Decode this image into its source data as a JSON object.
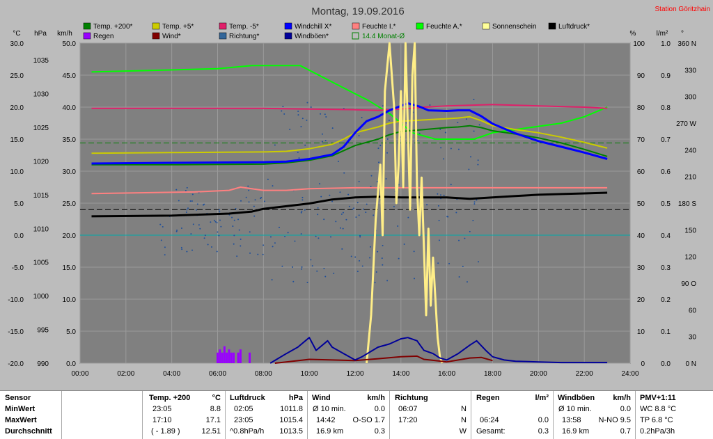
{
  "title": "Montag, 19.09.2016",
  "station": "Station Göritzhain",
  "axis_units": {
    "celsius": "°C",
    "hpa": "hPa",
    "kmh": "km/h",
    "percent": "%",
    "rain": "l/m²",
    "deg": "°"
  },
  "chart_data": {
    "type": "line",
    "x_ticks": [
      "00:00",
      "02:00",
      "04:00",
      "06:00",
      "08:00",
      "10:00",
      "12:00",
      "14:00",
      "16:00",
      "18:00",
      "20:00",
      "22:00",
      "24:00"
    ],
    "xlim": [
      0,
      24
    ],
    "axes": {
      "temp_c": {
        "min": -20,
        "max": 30,
        "ticks": [
          "-20.0",
          "-15.0",
          "-10.0",
          "-5.0",
          "0.0",
          "5.0",
          "10.0",
          "15.0",
          "20.0",
          "25.0",
          "30.0"
        ]
      },
      "pressure_hpa": {
        "min": 990,
        "max": 1037.5,
        "ticks": [
          "990",
          "995",
          "1000",
          "1005",
          "1010",
          "1015",
          "1020",
          "1025",
          "1030",
          "1035"
        ]
      },
      "wind_kmh": {
        "min": 0,
        "max": 50,
        "ticks": [
          "0.0",
          "5.0",
          "10.0",
          "15.0",
          "20.0",
          "25.0",
          "30.0",
          "35.0",
          "40.0",
          "45.0",
          "50.0"
        ]
      },
      "percent": {
        "min": 0,
        "max": 100,
        "ticks": [
          "0",
          "10",
          "20",
          "30",
          "40",
          "50",
          "60",
          "70",
          "80",
          "90",
          "100"
        ]
      },
      "rain": {
        "min": 0,
        "max": 1,
        "ticks": [
          "0.0",
          "0.1",
          "0.2",
          "0.3",
          "0.4",
          "0.5",
          "0.6",
          "0.7",
          "0.8",
          "0.9",
          "1.0"
        ]
      },
      "direction": {
        "min": 0,
        "max": 360,
        "ticks": [
          "0 N",
          "30",
          "60",
          "90 O",
          "120",
          "150",
          "180 S",
          "210",
          "240",
          "270 W",
          "300",
          "330",
          "360 N"
        ]
      }
    },
    "legend": [
      {
        "name": "Temp. +200*",
        "color": "#008000"
      },
      {
        "name": "Temp. +5*",
        "color": "#cccc00"
      },
      {
        "name": "Temp. -5*",
        "color": "#e0206a"
      },
      {
        "name": "Windchill X*",
        "color": "#0000ff"
      },
      {
        "name": "Feuchte I.*",
        "color": "#ff8080"
      },
      {
        "name": "Feuchte A.*",
        "color": "#00ff00"
      },
      {
        "name": "Sonnenschein",
        "color": "#ffff99"
      },
      {
        "name": "Luftdruck*",
        "color": "#000000"
      },
      {
        "name": "Regen",
        "color": "#9900ff"
      },
      {
        "name": "Wind*",
        "color": "#800000"
      },
      {
        "name": "Richtung*",
        "color": "#336699"
      },
      {
        "name": "Windböen*",
        "color": "#000099"
      },
      {
        "name": "14.4 Monat-Ø",
        "color": "#008000"
      }
    ],
    "reference_lines": [
      {
        "name": "14.4 Monat-Ø",
        "axis": "temp_c",
        "value": 14.4,
        "color": "#008000",
        "dash": true
      },
      {
        "name": "pressure-ref",
        "axis": "temp_c",
        "value": 4.0,
        "color": "#000000",
        "dash": true
      },
      {
        "name": "zero-line",
        "axis": "temp_c",
        "value": 0.0,
        "color": "#00aaaa",
        "dash": false
      }
    ],
    "series": [
      {
        "name": "Feuchte A.*",
        "axis": "percent",
        "color": "#00ff00",
        "width": 2,
        "x": [
          0.5,
          6,
          7.5,
          9.6,
          11.5,
          12.6,
          13.5,
          14.5,
          15.5,
          16.5,
          17.2,
          18,
          19,
          20,
          21,
          22,
          23
        ],
        "y": [
          91,
          92,
          93,
          93,
          86,
          82,
          78,
          72,
          70,
          70,
          70,
          72,
          73,
          74,
          75,
          77,
          80
        ]
      },
      {
        "name": "Temp. -5*",
        "axis": "temp_c",
        "color": "#e0206a",
        "width": 2,
        "x": [
          0.5,
          4,
          8,
          10,
          12,
          13,
          14,
          15,
          16,
          17,
          18,
          19,
          20,
          21,
          22,
          23
        ],
        "y": [
          19.8,
          19.8,
          19.8,
          19.7,
          19.6,
          19.5,
          19.7,
          20.0,
          20.2,
          20.3,
          20.4,
          20.3,
          20.2,
          20.1,
          20.0,
          19.8
        ]
      },
      {
        "name": "Temp. +5*",
        "axis": "temp_c",
        "color": "#cccc00",
        "width": 2,
        "x": [
          0.5,
          4,
          8,
          9,
          10,
          11,
          11.5,
          12,
          13,
          13.5,
          14,
          15,
          16,
          16.5,
          17,
          17.5,
          18,
          19,
          20,
          21,
          22,
          23
        ],
        "y": [
          12.8,
          12.9,
          13.0,
          13.1,
          13.5,
          14.2,
          15.0,
          16.0,
          16.9,
          17.5,
          17.8,
          18.0,
          18.2,
          18.3,
          18.5,
          17.9,
          17.1,
          16.5,
          16.0,
          15.3,
          14.5,
          13.6
        ]
      },
      {
        "name": "Temp. +200*",
        "axis": "temp_c",
        "color": "#008000",
        "width": 2,
        "x": [
          0.5,
          4,
          8,
          9,
          10,
          11,
          11.5,
          12,
          13,
          13.5,
          14,
          15,
          16,
          16.5,
          17,
          17.5,
          18,
          19,
          20,
          21,
          22,
          23
        ],
        "y": [
          11.0,
          11.0,
          11.1,
          11.3,
          11.7,
          12.4,
          13.2,
          14.0,
          15.0,
          15.7,
          16.2,
          16.5,
          16.8,
          16.9,
          17.1,
          16.8,
          16.3,
          15.8,
          15.2,
          14.4,
          13.4,
          12.3
        ]
      },
      {
        "name": "Windchill X*",
        "axis": "temp_c",
        "color": "#0000ff",
        "width": 3,
        "x": [
          0.5,
          4,
          8,
          9,
          10,
          11,
          11.5,
          12,
          12.5,
          13,
          13.5,
          14,
          14.3,
          14.8,
          15.2,
          16,
          16.5,
          17,
          17.5,
          18,
          19,
          20,
          21,
          22,
          23
        ],
        "y": [
          11.2,
          11.3,
          11.4,
          11.5,
          11.9,
          12.6,
          13.8,
          16.0,
          17.8,
          18.5,
          19.5,
          20.2,
          20.6,
          20.1,
          19.5,
          19.4,
          19.5,
          19.5,
          18.6,
          17.4,
          15.9,
          14.7,
          13.8,
          12.9,
          11.9
        ]
      },
      {
        "name": "Feuchte I.*",
        "axis": "percent",
        "color": "#ff8080",
        "width": 2,
        "x": [
          0.5,
          5,
          6.5,
          7,
          8,
          9,
          10,
          12,
          14,
          16,
          18,
          20,
          23
        ],
        "y": [
          53,
          53.5,
          54,
          55,
          54,
          54,
          54.5,
          54.8,
          54.8,
          54.8,
          54.8,
          54.8,
          54.8
        ]
      },
      {
        "name": "Luftdruck*",
        "axis": "pressure_hpa",
        "color": "#000000",
        "width": 3,
        "x": [
          0.5,
          4,
          6.5,
          7.5,
          8,
          9,
          10,
          11,
          12,
          13,
          14,
          15,
          16,
          17,
          18,
          19,
          20,
          21,
          22,
          23
        ],
        "y": [
          1011.8,
          1011.9,
          1012.2,
          1012.5,
          1012.9,
          1013.3,
          1013.7,
          1014.3,
          1014.6,
          1014.7,
          1014.6,
          1014.6,
          1014.6,
          1014.4,
          1014.6,
          1014.8,
          1015.0,
          1015.1,
          1015.2,
          1015.3
        ]
      },
      {
        "name": "Sonnenschein",
        "axis": "percent",
        "color": "#ffee88",
        "width": 3,
        "x": [
          12.5,
          12.7,
          12.9,
          13.1,
          13.2,
          13.3,
          13.5,
          13.7,
          13.8,
          13.9,
          14.0,
          14.1,
          14.2,
          14.4,
          14.5,
          14.6,
          14.7,
          14.8,
          14.9,
          15.1,
          15.2,
          15.3,
          15.4,
          15.6,
          15.7,
          15.8
        ],
        "y": [
          0,
          15,
          45,
          62,
          40,
          85,
          100,
          80,
          50,
          62,
          85,
          55,
          100,
          48,
          90,
          100,
          55,
          40,
          58,
          15,
          42,
          18,
          33,
          8,
          2,
          0
        ]
      },
      {
        "name": "Wind*",
        "axis": "wind_kmh",
        "color": "#800000",
        "width": 2,
        "x": [
          8.5,
          9,
          10,
          11,
          12,
          13,
          14,
          14.7,
          15,
          15.5,
          16,
          17,
          17.5,
          18
        ],
        "y": [
          0,
          0.2,
          0.6,
          0.5,
          0.4,
          0.7,
          1.0,
          1.1,
          0.6,
          0.4,
          0.2,
          0.8,
          0.9,
          0.4
        ]
      },
      {
        "name": "Windböen*",
        "axis": "wind_kmh",
        "color": "#000099",
        "width": 2,
        "x": [
          8.3,
          9,
          9.5,
          10,
          10.3,
          10.8,
          11,
          11.5,
          12,
          12.3,
          13,
          13.5,
          14,
          14.3,
          14.7,
          15,
          15.4,
          15.7,
          16,
          16.5,
          17,
          17.3,
          17.7,
          18,
          18.5,
          19,
          20,
          21,
          22,
          23
        ],
        "y": [
          0,
          1.5,
          2.5,
          4.0,
          2.0,
          3.5,
          2.5,
          1.5,
          0.5,
          1.0,
          2.5,
          3.0,
          3.8,
          4.0,
          3.5,
          2.0,
          1.5,
          0.8,
          0.5,
          1.5,
          2.8,
          3.5,
          2.0,
          1.0,
          0.5,
          0.3,
          0.2,
          0.1,
          0.1,
          0.1
        ]
      }
    ],
    "rain_bars": {
      "axis": "rain",
      "color": "#9900ff",
      "x": [
        6.0,
        6.1,
        6.2,
        6.3,
        6.4,
        6.5,
        6.6,
        6.7,
        6.9,
        7.0,
        7.4
      ],
      "y": [
        0.02,
        0.03,
        0.02,
        0.04,
        0.02,
        0.03,
        0.02,
        0.02,
        0.02,
        0.03,
        0.02
      ]
    }
  },
  "stats": {
    "sensor": {
      "header": "Sensor",
      "rows": [
        "MinWert",
        "MaxWert",
        "Durchschnitt"
      ]
    },
    "temp": {
      "header": "Temp. +200",
      "unit": "°C",
      "rows": [
        [
          "23:05",
          "8.8"
        ],
        [
          "17:10",
          "17.1"
        ],
        [
          "( - 1.89 )",
          "12.51"
        ]
      ]
    },
    "pressure": {
      "header": "Luftdruck",
      "unit": "hPa",
      "rows": [
        [
          "02:05",
          "1011.8"
        ],
        [
          "23:05",
          "1015.4"
        ],
        [
          "^0.8hPa/h",
          "1013.5"
        ]
      ]
    },
    "wind": {
      "header": "Wind",
      "unit": "km/h",
      "rows": [
        [
          "Ø 10 min.",
          "0.0"
        ],
        [
          "14:42",
          "O-SO 1.7"
        ],
        [
          "16.9 km",
          "0.3"
        ]
      ]
    },
    "direction": {
      "header": "Richtung",
      "rows": [
        [
          "06:07",
          "N"
        ],
        [
          "17:20",
          "N"
        ],
        [
          "",
          "W"
        ]
      ]
    },
    "rain": {
      "header": "Regen",
      "unit": "l/m²",
      "rows": [
        [
          "",
          ""
        ],
        [
          "06:24",
          "0.0"
        ],
        [
          "Gesamt:",
          "0.3"
        ]
      ]
    },
    "gusts": {
      "header": "Windböen",
      "unit": "km/h",
      "rows": [
        [
          "Ø 10 min.",
          "0.0"
        ],
        [
          "13:58",
          "N-NO 9.5"
        ],
        [
          "16.9 km",
          "0.7"
        ]
      ]
    },
    "pmv": {
      "header": "PMV+1:11",
      "rows": [
        "WC 8.8 °C",
        "TP 6.8 °C",
        "0.2hPa/3h"
      ]
    }
  }
}
